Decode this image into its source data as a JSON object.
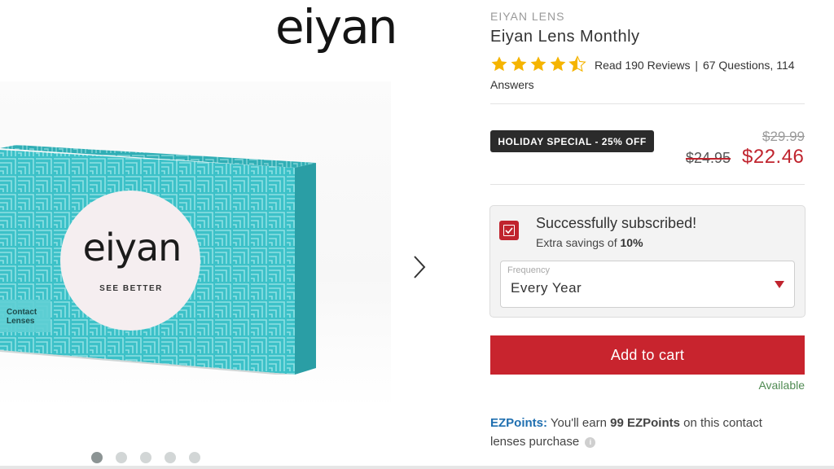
{
  "gallery": {
    "logo_text": "eiyan",
    "box_logo": "eiyan",
    "box_tagline": "SEE BETTER",
    "box_side_label": "Contact Lenses",
    "next_icon": "chevron-right-icon",
    "image_count": 5,
    "active_image": 1
  },
  "product": {
    "brand": "EIYAN LENS",
    "title": "Eiyan Lens Monthly",
    "rating": 4.5,
    "rating_max": 5,
    "reviews_text": "Read 190 Reviews",
    "separator": "|",
    "questions_text": "67 Questions, 114",
    "answers_text": "Answers"
  },
  "pricing": {
    "promo_badge": "HOLIDAY SPECIAL - 25% OFF",
    "msrp": "$29.99",
    "was_price": "$24.95",
    "sale_price": "$22.46"
  },
  "subscription": {
    "checked": true,
    "title": "Successfully subscribed!",
    "savings_prefix": "Extra savings of",
    "savings_value": "10%",
    "frequency_label": "Frequency",
    "frequency_value": "Every Year"
  },
  "cart": {
    "button_label": "Add to cart",
    "availability": "Available"
  },
  "ezpoints": {
    "label": "EZPoints:",
    "text_before": "You'll earn",
    "points": "99 EZPoints",
    "text_after": "on this contact lenses purchase"
  },
  "colors": {
    "accent_red": "#c8242e",
    "teal_box": "#3cc1c8",
    "ezpoints_blue": "#1f6fb0",
    "available_green": "#4f8a52"
  }
}
